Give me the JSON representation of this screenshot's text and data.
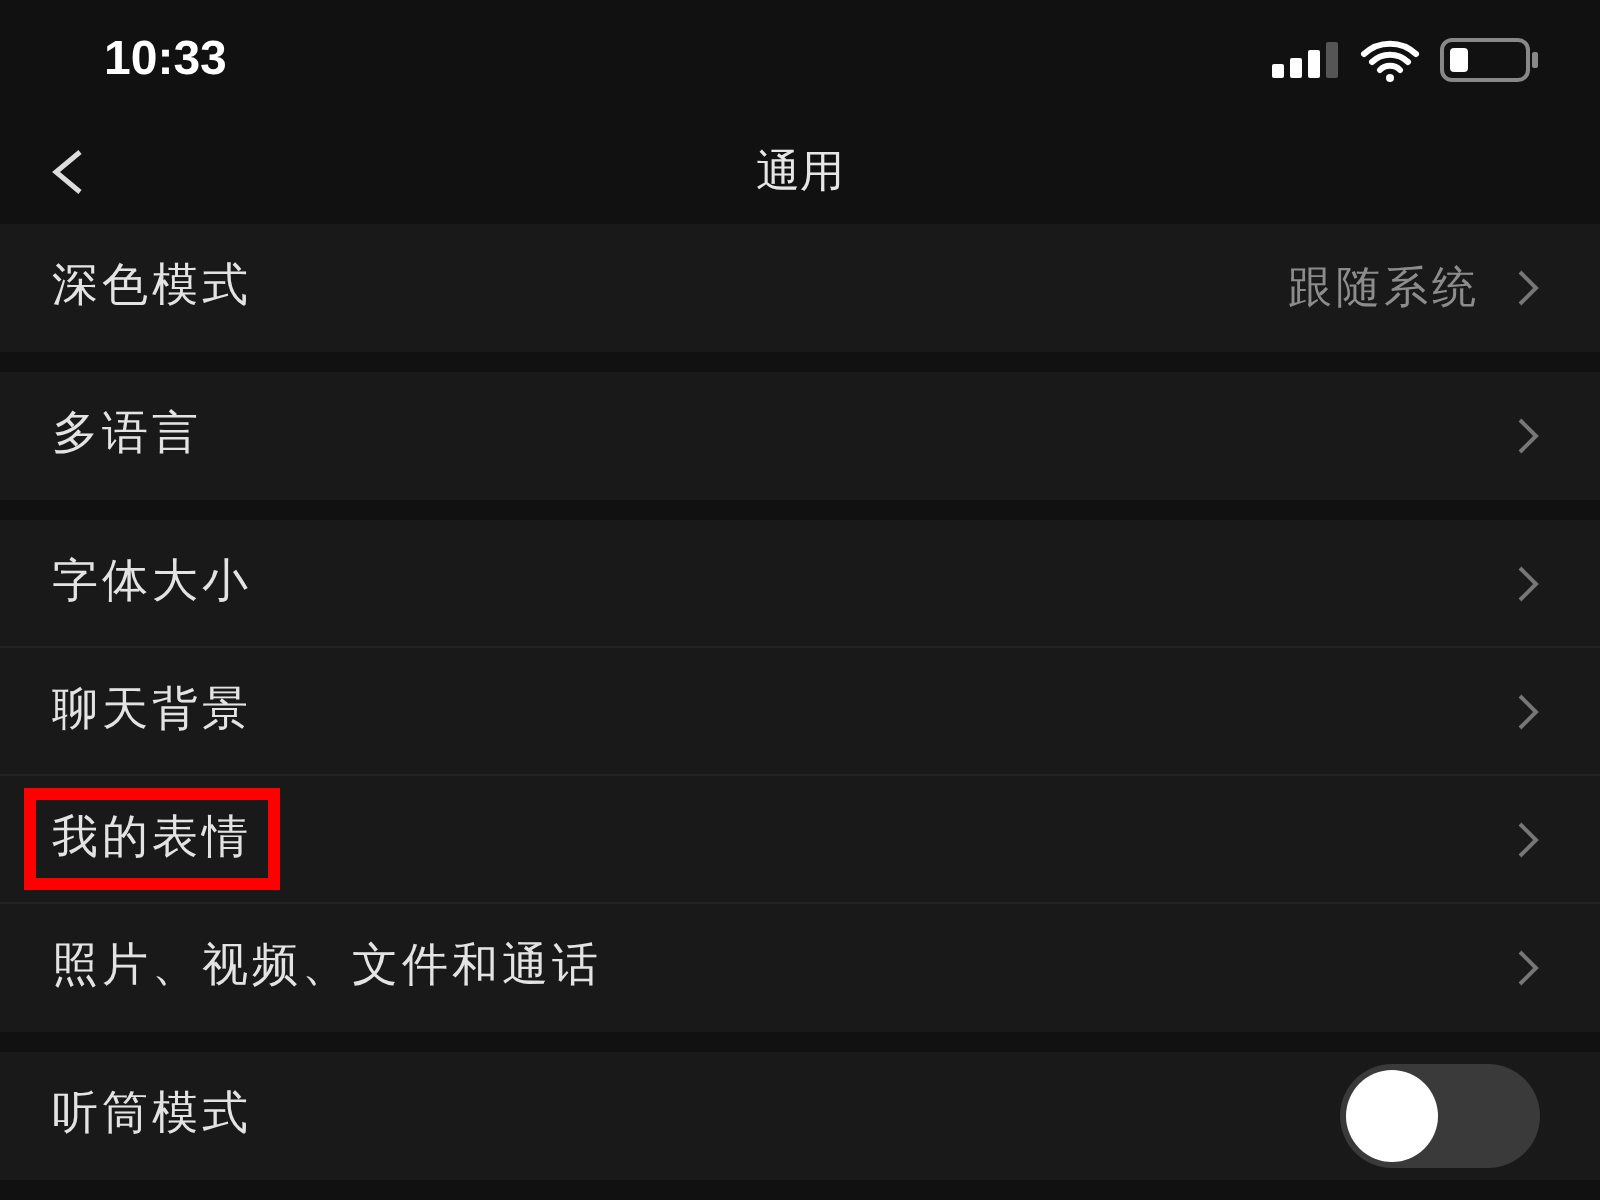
{
  "status_bar": {
    "time": "10:33"
  },
  "nav": {
    "title": "通用"
  },
  "groups": [
    {
      "items": [
        {
          "kind": "link",
          "label": "深色模式",
          "value": "跟随系统",
          "highlighted": false
        }
      ]
    },
    {
      "items": [
        {
          "kind": "link",
          "label": "多语言",
          "highlighted": false
        }
      ]
    },
    {
      "items": [
        {
          "kind": "link",
          "label": "字体大小",
          "highlighted": false
        },
        {
          "kind": "link",
          "label": "聊天背景",
          "highlighted": false
        },
        {
          "kind": "link",
          "label": "我的表情",
          "highlighted": true
        },
        {
          "kind": "link",
          "label": "照片、视频、文件和通话",
          "highlighted": false
        }
      ]
    },
    {
      "items": [
        {
          "kind": "toggle",
          "label": "听筒模式",
          "on": false,
          "highlighted": false
        }
      ]
    }
  ]
}
